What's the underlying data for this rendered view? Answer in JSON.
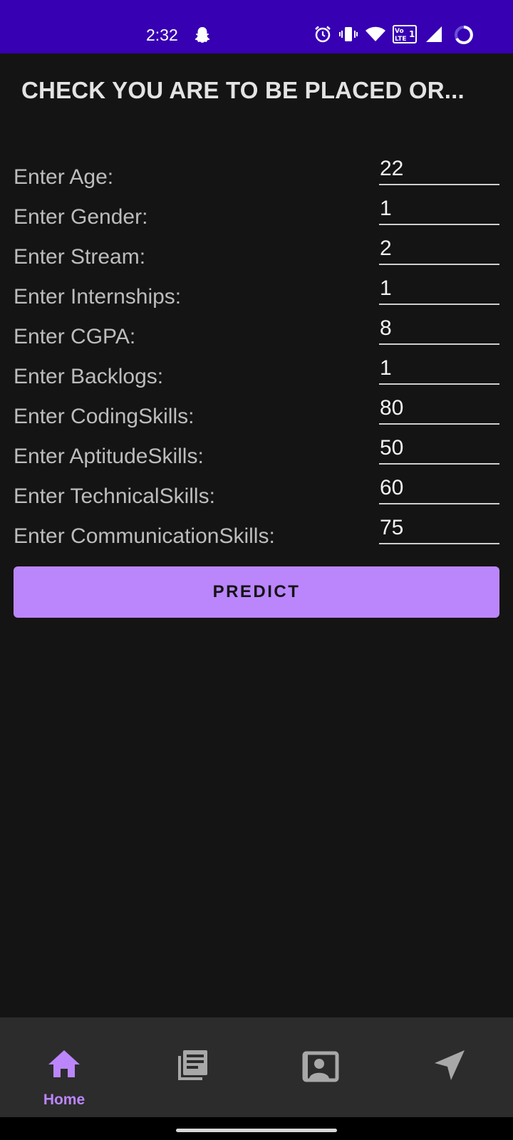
{
  "status_bar": {
    "time": "2:32",
    "icons": [
      "snapchat-icon",
      "alarm-icon",
      "vibrate-icon",
      "wifi-icon",
      "volte-icon",
      "signal-icon",
      "battery-icon"
    ],
    "background_color": "#3700b3"
  },
  "title": "CHECK YOU ARE TO BE  PLACED OR...",
  "form": {
    "fields": [
      {
        "label": "Enter Age:",
        "value": "22"
      },
      {
        "label": "Enter Gender:",
        "value": "1"
      },
      {
        "label": "Enter Stream:",
        "value": "2"
      },
      {
        "label": "Enter Internships:",
        "value": "1"
      },
      {
        "label": "Enter CGPA:",
        "value": "8"
      },
      {
        "label": "Enter Backlogs:",
        "value": "1"
      },
      {
        "label": "Enter CodingSkills:",
        "value": "80"
      },
      {
        "label": "Enter AptitudeSkills:",
        "value": "50"
      },
      {
        "label": "Enter TechnicalSkills:",
        "value": "60"
      },
      {
        "label": "Enter CommunicationSkills:",
        "value": "75"
      }
    ]
  },
  "predict_button": {
    "label": "PREDICT",
    "color": "#bb86fc"
  },
  "bottom_nav": {
    "items": [
      {
        "label": "Home",
        "icon": "home-icon",
        "active": true
      },
      {
        "label": "",
        "icon": "news-icon",
        "active": false
      },
      {
        "label": "",
        "icon": "contact-card-icon",
        "active": false
      },
      {
        "label": "",
        "icon": "send-icon",
        "active": false
      }
    ],
    "active_color": "#bb86fc",
    "inactive_color": "#a8a8a8"
  }
}
